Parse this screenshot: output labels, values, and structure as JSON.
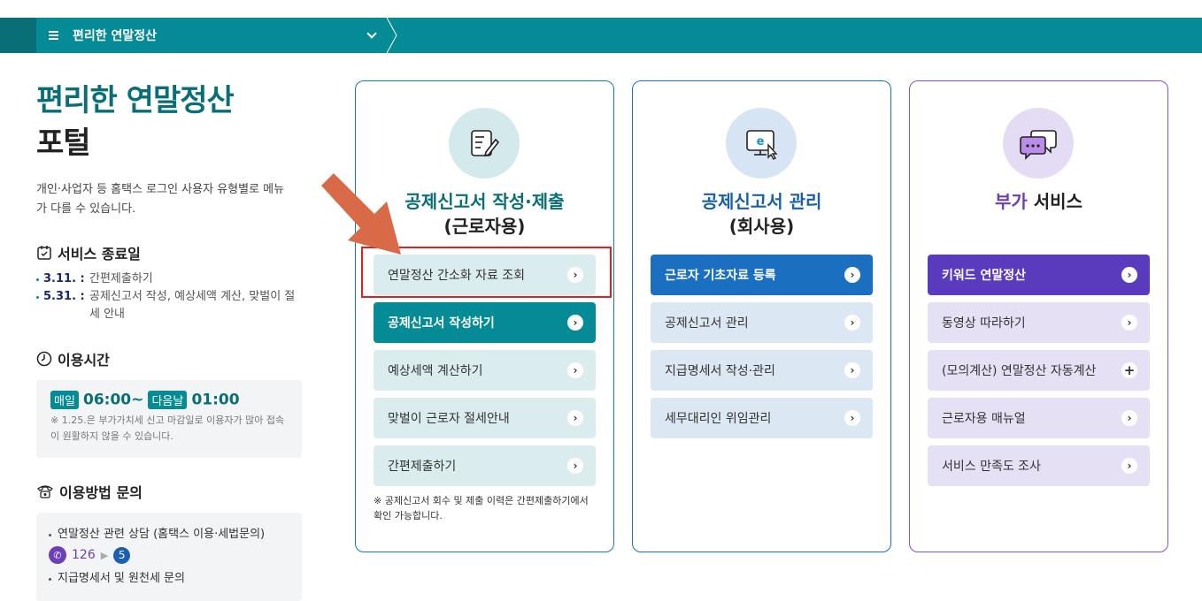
{
  "topbar": {
    "title": "편리한 연말정산"
  },
  "hero": {
    "line1": "편리한 연말정산",
    "line2": "포털",
    "desc": "개인·사업자 등 홈택스 로그인 사용자 유형별로 메뉴가 다를 수 있습니다."
  },
  "service_end": {
    "title": "서비스 종료일",
    "rows": [
      {
        "date": "3.11. :",
        "text": "간편제출하기"
      },
      {
        "date": "5.31. :",
        "text": "공제신고서 작성, 예상세액 계산, 맞벌이 절세 안내"
      }
    ]
  },
  "hours": {
    "title": "이용시간",
    "daily_badge": "매일",
    "start": "06:00~",
    "next_badge": "다음날",
    "end": "01:00",
    "note": "※ 1.25.은 부가가치세 신고 마감일로 이용자가 많아 접속이 원활하지 않을 수 있습니다."
  },
  "inquiry": {
    "title": "이용방법 문의",
    "item1": "연말정산 관련 상담 (홈택스 이용·세법문의)",
    "phone": "126",
    "ext": "5",
    "item2": "지급명세서 및 원천세 문의"
  },
  "cards": [
    {
      "title_hl": "공제신고서 작성·제출",
      "title_sub": "(근로자용)",
      "icon": "form-edit-icon",
      "buttons": [
        "연말정산 간소화 자료 조회",
        "공제신고서 작성하기",
        "예상세액 계산하기",
        "맞벌이 근로자 절세안내",
        "간편제출하기"
      ],
      "note": "※ 공제신고서 회수 및 제출 이력은 간편제출하기에서 확인 가능합니다."
    },
    {
      "title_hl": "공제신고서 관리",
      "title_sub": "(회사용)",
      "icon": "e-monitor-icon",
      "buttons": [
        "근로자 기초자료 등록",
        "공제신고서 관리",
        "지급명세서 작성·관리",
        "세무대리인 위임관리"
      ]
    },
    {
      "title_hl": "부가",
      "title_rest": " 서비스",
      "icon": "chat-bubbles-icon",
      "buttons": [
        "키워드 연말정산",
        "동영상 따라하기",
        "(모의계산) 연말정산 자동계산",
        "근로자용 매뉴얼",
        "서비스 만족도 조사"
      ]
    }
  ],
  "colors": {
    "teal": "#058b96",
    "blue": "#1a6fc0",
    "purple": "#5a3bbd",
    "annotation_red": "#e02020",
    "annotation_arrow": "#d96a48"
  }
}
